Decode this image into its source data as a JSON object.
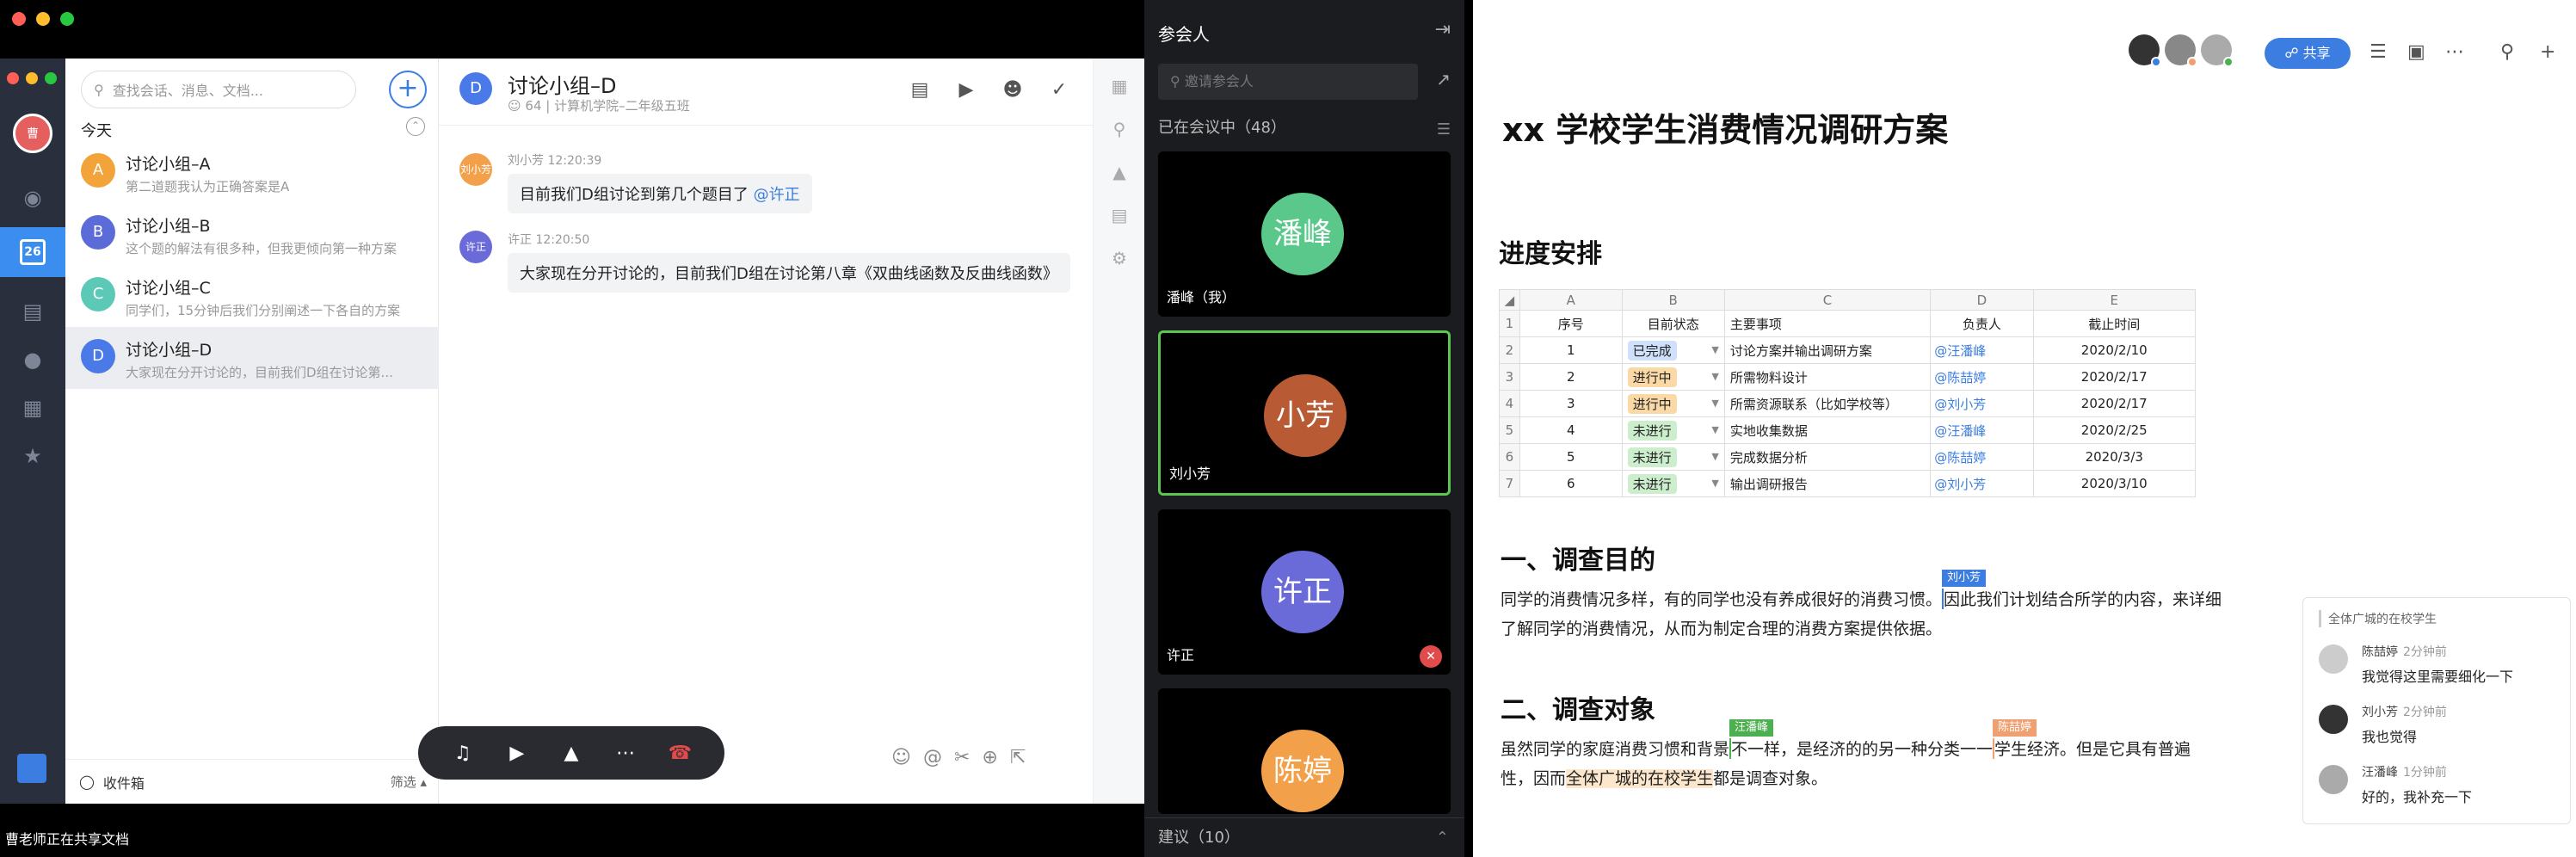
{
  "chat": {
    "me_avatar": "曹",
    "calendar_day": "26",
    "search_placeholder": "查找会话、消息、文档...",
    "add": "+",
    "section_label": "今天",
    "conversations": [
      {
        "avatar": "A",
        "name": "讨论小组–A",
        "preview": "第二道题我认为正确答案是A",
        "color": "#f2a33a"
      },
      {
        "avatar": "B",
        "name": "讨论小组–B",
        "preview": "这个题的解法有很多种，但我更倾向第一种方案",
        "color": "#5b6cd9"
      },
      {
        "avatar": "C",
        "name": "讨论小组–C",
        "preview": "同学们，15分钟后我们分别阐述一下各自的方案",
        "color": "#5cc9b6"
      },
      {
        "avatar": "D",
        "name": "讨论小组–D",
        "preview": "大家现在分开讨论的，目前我们D组在讨论第...",
        "color": "#4a79e8"
      }
    ],
    "inbox_label": "收件箱",
    "filter_label": "筛选 ▴",
    "header": {
      "avatar": "D",
      "title": "讨论小组–D",
      "members": "64",
      "org": "计算机学院–二年级五班"
    },
    "messages": [
      {
        "avatar": "刘小芳",
        "sender": "刘小芳",
        "time": "12:20:39",
        "text": "目前我们D组讨论到第几个题目了",
        "mention": "@许正",
        "color": "#f2a04a"
      },
      {
        "avatar": "许正",
        "sender": "许正",
        "time": "12:20:50",
        "text": "大家现在分开讨论的，目前我们D组在讨论第八章《双曲线函数及反曲线函数》",
        "mention": "",
        "color": "#6a6ad8"
      }
    ],
    "sharing_status": "曹老师正在共享文档"
  },
  "participants": {
    "title": "参会人",
    "search_placeholder": "邀请参会人",
    "in_meeting": "已在会议中（48）",
    "tiles": [
      {
        "initials": "潘峰",
        "label": "潘峰（我）",
        "color": "#5ac88a",
        "speaking": false,
        "muted": false
      },
      {
        "initials": "小芳",
        "label": "刘小芳",
        "color": "#b85a34",
        "speaking": true,
        "muted": false
      },
      {
        "initials": "许正",
        "label": "许正",
        "color": "#6a6ad8",
        "speaking": false,
        "muted": true
      },
      {
        "initials": "陈婷",
        "label": "",
        "color": "#f2a04a",
        "speaking": false,
        "muted": false
      }
    ],
    "suggest": "建议（10）"
  },
  "doc": {
    "share_label": "共享",
    "title": "xx 学校学生消费情况调研方案",
    "section_schedule": "进度安排",
    "sheet": {
      "col_letters": [
        "A",
        "B",
        "C",
        "D",
        "E"
      ],
      "headers": [
        "序号",
        "目前状态",
        "主要事项",
        "负责人",
        "截止时间"
      ],
      "rows": [
        {
          "no": "1",
          "status": "已完成",
          "kind": "done",
          "task": "讨论方案并输出调研方案",
          "owner": "@汪潘峰",
          "due": "2020/2/10"
        },
        {
          "no": "2",
          "status": "进行中",
          "kind": "doing",
          "task": "所需物料设计",
          "owner": "@陈喆婷",
          "due": "2020/2/17"
        },
        {
          "no": "3",
          "status": "进行中",
          "kind": "doing",
          "task": "所需资源联系（比如学校等）",
          "owner": "@刘小芳",
          "due": "2020/2/17"
        },
        {
          "no": "4",
          "status": "未进行",
          "kind": "todo",
          "task": "实地收集数据",
          "owner": "@汪潘峰",
          "due": "2020/2/25"
        },
        {
          "no": "5",
          "status": "未进行",
          "kind": "todo",
          "task": "完成数据分析",
          "owner": "@陈喆婷",
          "due": "2020/3/3"
        },
        {
          "no": "6",
          "status": "未进行",
          "kind": "todo",
          "task": "输出调研报告",
          "owner": "@刘小芳",
          "due": "2020/3/10"
        }
      ]
    },
    "sec1": "一、调查目的",
    "p1a": "同学的消费情况多样，有的同学也没有养成很好的消费习惯。",
    "p1b": "因此我们计划结合所学的内容，来详细了解同学的消费情况，从而为制定合理的消费方案提供依据。",
    "cursor1": "刘小芳",
    "sec2": "二、调查对象",
    "p2a": "虽然同学的家庭消费习惯和背景",
    "p2b": "不一样，是经济的的另一种分类一一",
    "p2c": "学生经济。但是它具有普遍性，因而",
    "p2d": "全体广城的在校学生",
    "p2e": "都是调查对象。",
    "cursor2": "汪潘峰",
    "cursor3": "陈喆婷",
    "comments": {
      "quote": "全体广城的在校学生",
      "items": [
        {
          "name": "陈喆婷",
          "time": "2分钟前",
          "text": "我觉得这里需要细化一下"
        },
        {
          "name": "刘小芳",
          "time": "2分钟前",
          "text": "我也觉得"
        },
        {
          "name": "汪潘峰",
          "time": "1分钟前",
          "text": "好的，我补充一下"
        }
      ]
    }
  },
  "colors": {
    "accent": "#3b7de0",
    "cursor_liu": "#3b7de0",
    "cursor_wang": "#4caf50",
    "cursor_chen": "#f0a070"
  }
}
